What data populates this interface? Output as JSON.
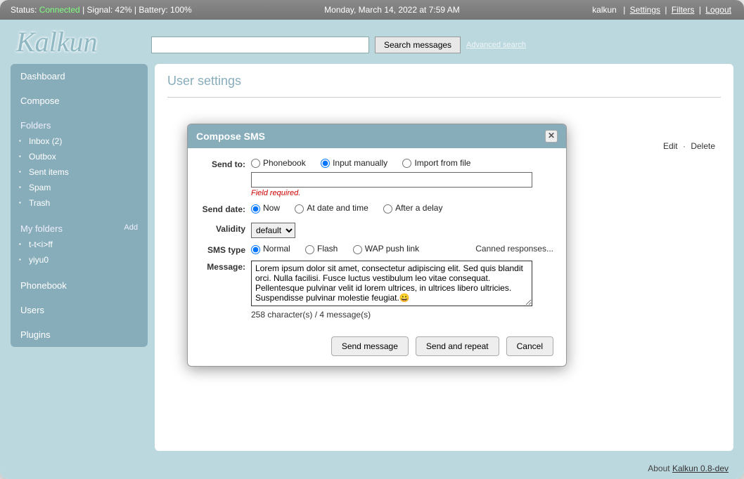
{
  "topbar": {
    "status_prefix": "Status: ",
    "status_value": "Connected",
    "signal": " | Signal: 42% | Battery: 100%",
    "datetime": "Monday, March 14, 2022 at 7:59 AM",
    "appname": "kalkun",
    "link_settings": "Settings",
    "link_filters": "Filters",
    "link_logout": "Logout"
  },
  "logo": "Kalkun",
  "search": {
    "placeholder": "",
    "button": "Search messages",
    "advanced": "Advanced search"
  },
  "sidebar": {
    "dashboard": "Dashboard",
    "compose": "Compose",
    "folders_label": "Folders",
    "folders": [
      {
        "label": "Inbox (2)"
      },
      {
        "label": "Outbox"
      },
      {
        "label": "Sent items"
      },
      {
        "label": "Spam"
      },
      {
        "label": "Trash"
      }
    ],
    "myfolders_label": "My folders",
    "add": "Add",
    "myfolders": [
      {
        "label": "t-t<i>ff"
      },
      {
        "label": "yiyu0"
      }
    ],
    "phonebook": "Phonebook",
    "users": "Users",
    "plugins": "Plugins"
  },
  "main": {
    "title": "User settings",
    "edit": "Edit",
    "delete": "Delete"
  },
  "footer": {
    "about": "About ",
    "product": "Kalkun 0.8-dev"
  },
  "dialog": {
    "title": "Compose SMS",
    "sendto_label": "Send to:",
    "sendto_opts": [
      "Phonebook",
      "Input manually",
      "Import from file"
    ],
    "sendto_selected": 1,
    "recipient_error": "Field required.",
    "senddate_label": "Send date:",
    "senddate_opts": [
      "Now",
      "At date and time",
      "After a delay"
    ],
    "senddate_selected": 0,
    "validity_label": "Validity",
    "validity_value": "default",
    "smstype_label": "SMS type",
    "smstype_opts": [
      "Normal",
      "Flash",
      "WAP push link"
    ],
    "smstype_selected": 0,
    "canned": "Canned responses...",
    "message_label": "Message:",
    "message_value": "Lorem ipsum dolor sit amet, consectetur adipiscing elit. Sed quis blandit orci. Nulla facilisi. Fusce luctus vestibulum leo vitae consequat. Pellentesque pulvinar velit id lorem ultrices, in ultrices libero ultricies. Suspendisse pulvinar molestie feugiat.😀",
    "char_count": "258 character(s) / 4 message(s)",
    "btn_send": "Send message",
    "btn_repeat": "Send and repeat",
    "btn_cancel": "Cancel"
  }
}
